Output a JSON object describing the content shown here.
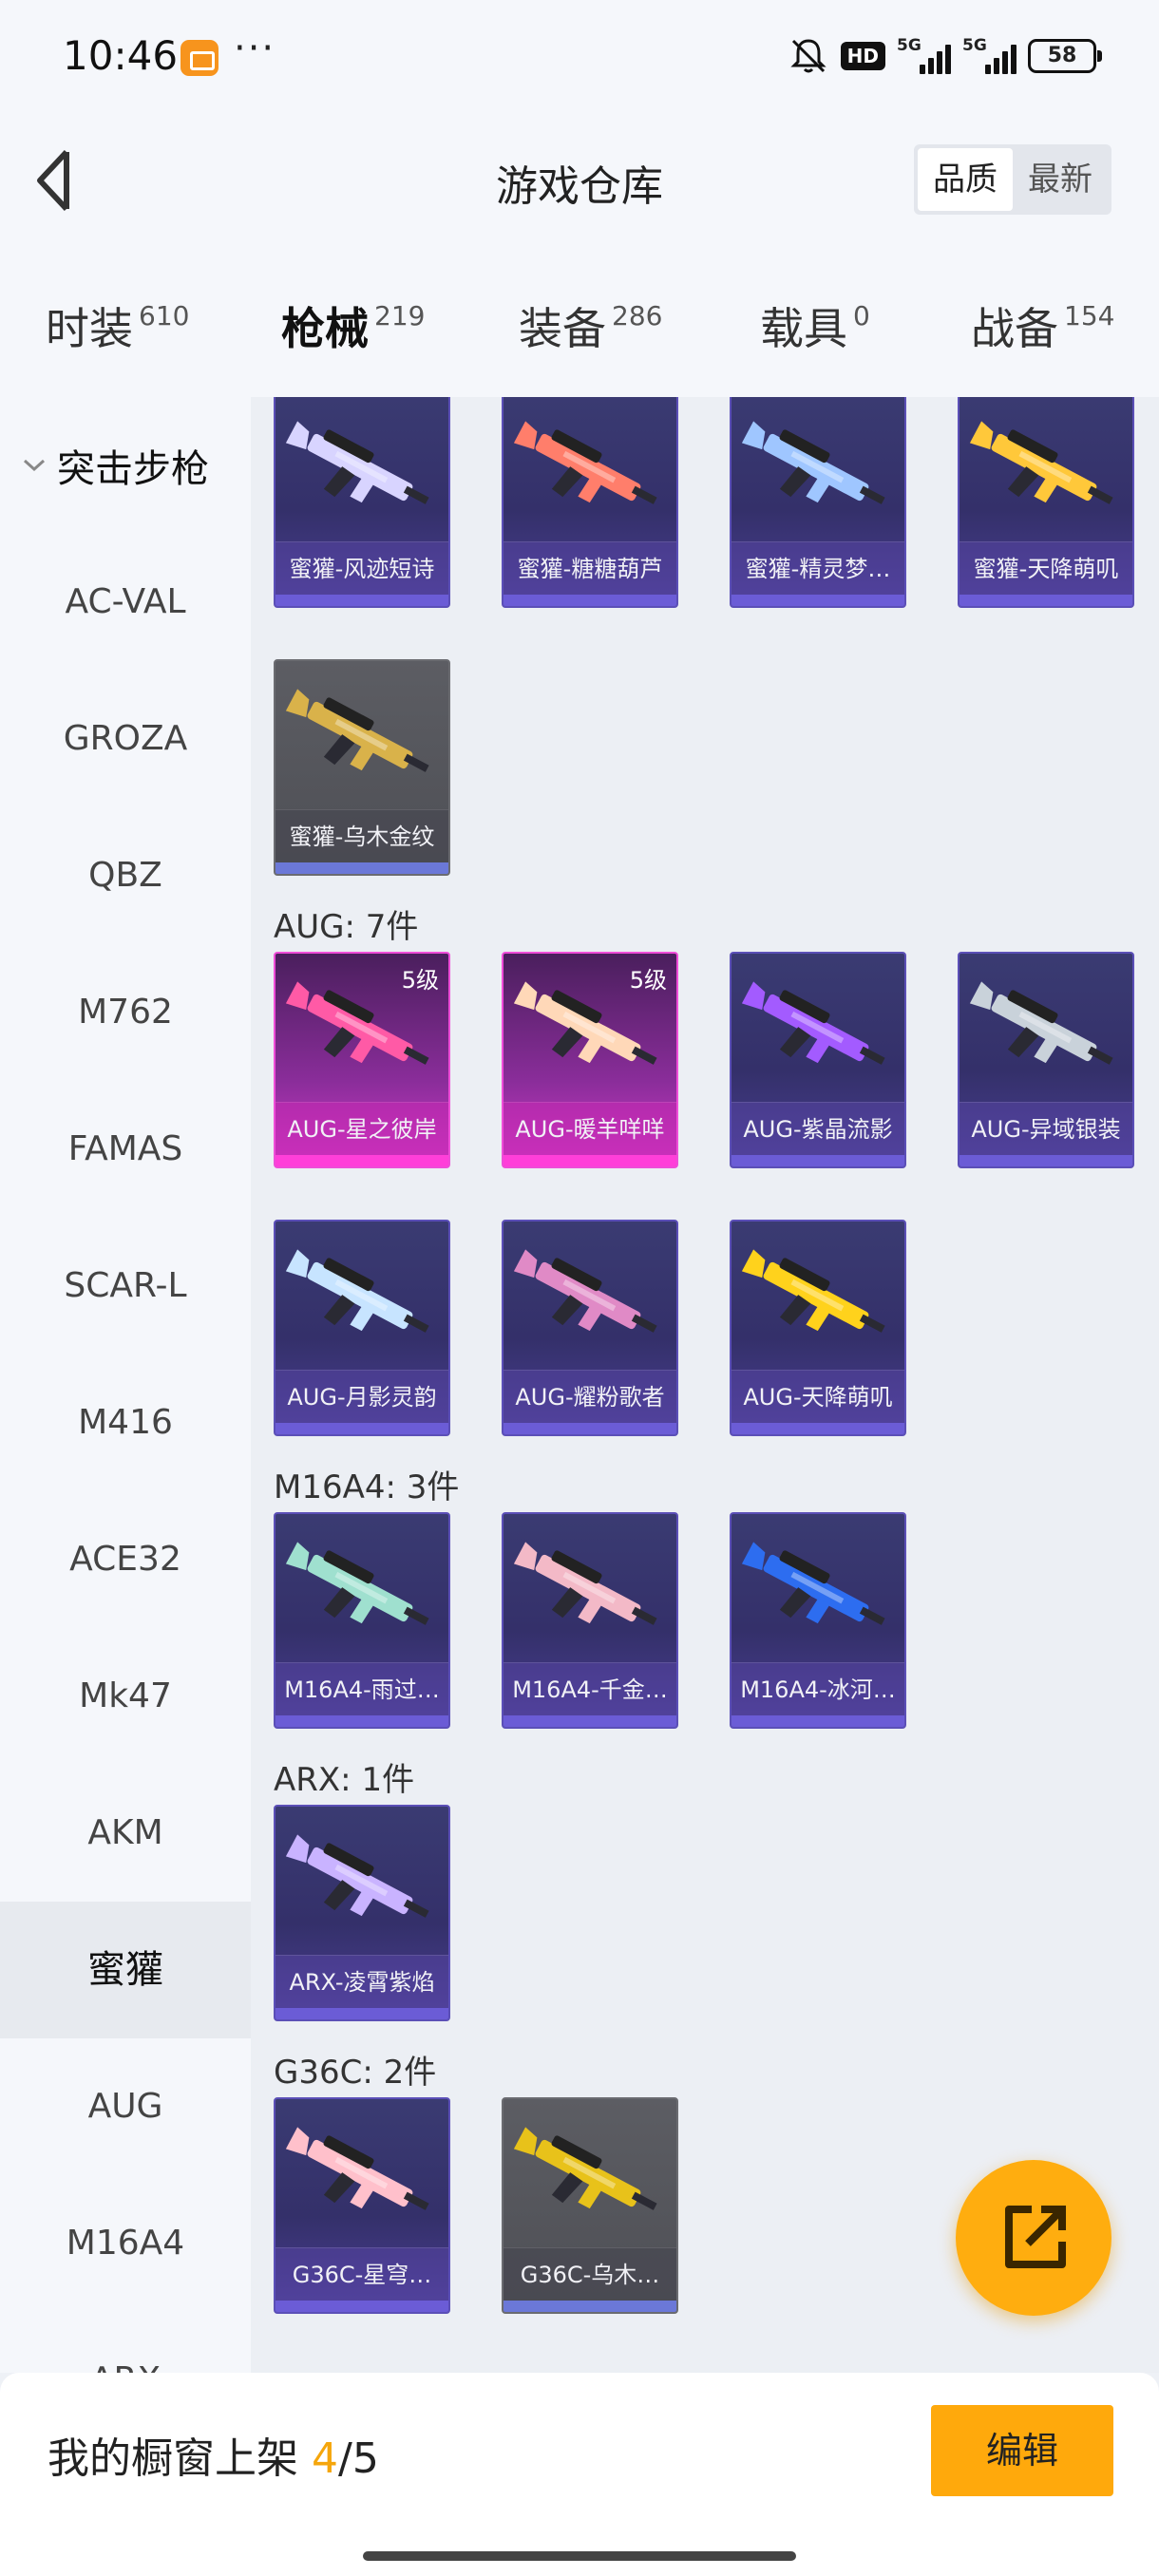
{
  "status_bar": {
    "time": "10:46",
    "dots": "···",
    "hd": "HD",
    "net1": "5G",
    "net2": "5G",
    "battery": "58",
    "icons": [
      "app-notification-icon",
      "mute-icon",
      "hd-icon",
      "signal-icon",
      "signal-icon",
      "battery-icon"
    ]
  },
  "header": {
    "title": "游戏仓库",
    "sort_options": [
      "品质",
      "最新"
    ],
    "active_sort": "品质"
  },
  "tabs": [
    {
      "label": "时装",
      "count": "610"
    },
    {
      "label": "枪械",
      "count": "219"
    },
    {
      "label": "装备",
      "count": "286"
    },
    {
      "label": "载具",
      "count": "0"
    },
    {
      "label": "战备",
      "count": "154"
    }
  ],
  "active_tab": "枪械",
  "sidebar": {
    "group_label": "突击步枪",
    "items": [
      "AC-VAL",
      "GROZA",
      "QBZ",
      "M762",
      "FAMAS",
      "SCAR-L",
      "M416",
      "ACE32",
      "Mk47",
      "AKM",
      "蜜獾",
      "AUG",
      "M16A4",
      "ARX"
    ],
    "active_item": "蜜獾"
  },
  "sections": [
    {
      "title": "",
      "items": [
        {
          "name": "蜜獾-风迹短诗",
          "style": "purple",
          "level": "",
          "color": "#d8d4ff"
        },
        {
          "name": "蜜獾-糖糖葫芦",
          "style": "purple",
          "level": "",
          "color": "#ff7e6b"
        },
        {
          "name": "蜜獾-精灵梦…",
          "style": "purple",
          "level": "",
          "color": "#9fc6ff"
        },
        {
          "name": "蜜獾-天降萌叽",
          "style": "purple",
          "level": "",
          "color": "#ffc83a"
        },
        {
          "name": "蜜獾-乌木金纹",
          "style": "grey",
          "level": "",
          "color": "#d9b24a"
        }
      ]
    },
    {
      "title": "AUG: 7件",
      "items": [
        {
          "name": "AUG-星之彼岸",
          "style": "pink",
          "level": "5级",
          "color": "#ff5aa6"
        },
        {
          "name": "AUG-暖羊咩咩",
          "style": "pink",
          "level": "5级",
          "color": "#ffd8b8"
        },
        {
          "name": "AUG-紫晶流影",
          "style": "purple",
          "level": "",
          "color": "#a35bff"
        },
        {
          "name": "AUG-异域银装",
          "style": "purple",
          "level": "",
          "color": "#c9d2da"
        },
        {
          "name": "AUG-月影灵韵",
          "style": "purple",
          "level": "",
          "color": "#c7e4ff"
        },
        {
          "name": "AUG-耀粉歌者",
          "style": "purple",
          "level": "",
          "color": "#e08ac6"
        },
        {
          "name": "AUG-天降萌叽",
          "style": "purple",
          "level": "",
          "color": "#ffd21c"
        }
      ]
    },
    {
      "title": "M16A4: 3件",
      "items": [
        {
          "name": "M16A4-雨过…",
          "style": "purple",
          "level": "",
          "color": "#9fe0cf"
        },
        {
          "name": "M16A4-千金…",
          "style": "purple",
          "level": "",
          "color": "#f3b9c7"
        },
        {
          "name": "M16A4-冰河…",
          "style": "purple",
          "level": "",
          "color": "#2d6df0"
        }
      ]
    },
    {
      "title": "ARX: 1件",
      "items": [
        {
          "name": "ARX-凌霄紫焰",
          "style": "purple",
          "level": "",
          "color": "#c9b3ff"
        }
      ]
    },
    {
      "title": "G36C: 2件",
      "items": [
        {
          "name": "G36C-星穹…",
          "style": "purple",
          "level": "",
          "color": "#ffc0cb"
        },
        {
          "name": "G36C-乌木…",
          "style": "grey",
          "level": "",
          "color": "#e8c21a"
        }
      ]
    }
  ],
  "bottom_bar": {
    "shelf_label": "我的橱窗上架",
    "shelf_count": "4",
    "shelf_total": "/5",
    "edit_label": "编辑"
  },
  "colors": {
    "accent": "#ffa90c",
    "card_purple": "#3a3b72",
    "card_pink": "#d13ac6",
    "card_grey": "#55565c"
  }
}
